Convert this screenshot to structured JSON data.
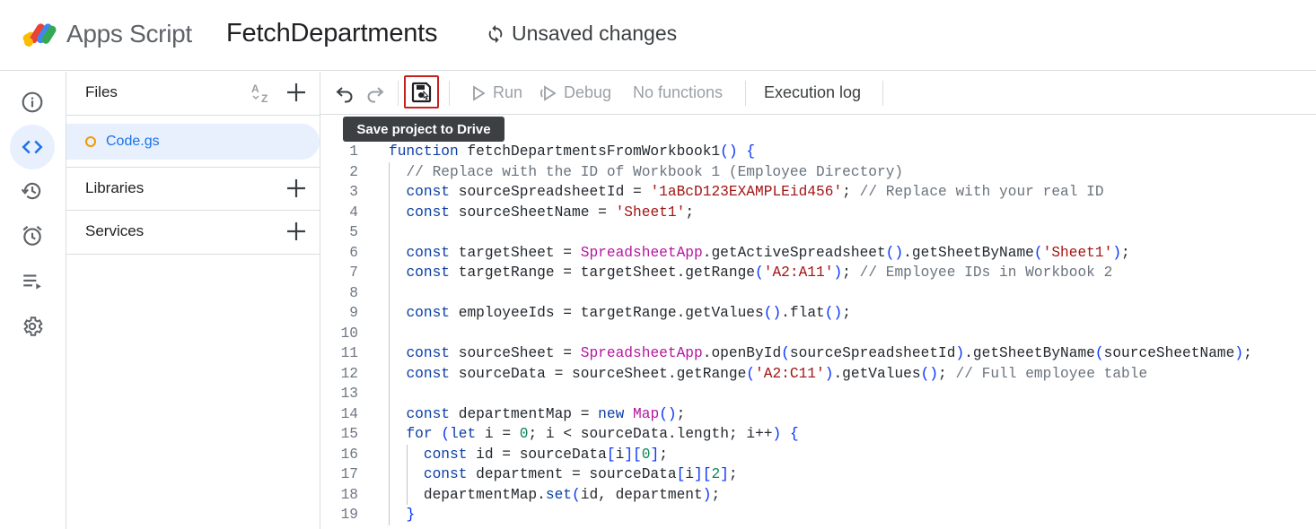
{
  "header": {
    "app_name": "Apps Script",
    "project_name": "FetchDepartments",
    "status": "Unsaved changes"
  },
  "rail": {
    "items": [
      {
        "name": "overview",
        "icon": "info-icon"
      },
      {
        "name": "editor",
        "icon": "code-icon",
        "active": true
      },
      {
        "name": "executions",
        "icon": "history-icon"
      },
      {
        "name": "triggers",
        "icon": "alarm-icon"
      },
      {
        "name": "execution-list",
        "icon": "playlist-icon"
      },
      {
        "name": "settings",
        "icon": "gear-icon"
      }
    ]
  },
  "files_panel": {
    "files_label": "Files",
    "sort_icon": "az-sort-icon",
    "files": [
      {
        "name": "Code.gs"
      }
    ],
    "libraries_label": "Libraries",
    "services_label": "Services"
  },
  "toolbar": {
    "run_label": "Run",
    "debug_label": "Debug",
    "function_select": "No functions",
    "execution_log_label": "Execution log",
    "save_tooltip": "Save project to Drive"
  },
  "colors": {
    "accent": "#1a73e8",
    "active_bg": "#e8f0fe",
    "save_highlight": "#c5221f",
    "unsaved_dot": "#f29900"
  },
  "code": {
    "language": "javascript",
    "lines": [
      {
        "n": "1",
        "text": "function fetchDepartmentsFromWorkbook1() {"
      },
      {
        "n": "2",
        "text": "  // Replace with the ID of Workbook 1 (Employee Directory)"
      },
      {
        "n": "3",
        "text": "  const sourceSpreadsheetId = '1aBcD123EXAMPLEid456'; // Replace with your real ID"
      },
      {
        "n": "4",
        "text": "  const sourceSheetName = 'Sheet1';"
      },
      {
        "n": "5",
        "text": ""
      },
      {
        "n": "6",
        "text": "  const targetSheet = SpreadsheetApp.getActiveSpreadsheet().getSheetByName('Sheet1');"
      },
      {
        "n": "7",
        "text": "  const targetRange = targetSheet.getRange('A2:A11'); // Employee IDs in Workbook 2"
      },
      {
        "n": "8",
        "text": ""
      },
      {
        "n": "9",
        "text": "  const employeeIds = targetRange.getValues().flat();"
      },
      {
        "n": "10",
        "text": ""
      },
      {
        "n": "11",
        "text": "  const sourceSheet = SpreadsheetApp.openById(sourceSpreadsheetId).getSheetByName(sourceSheetName);"
      },
      {
        "n": "12",
        "text": "  const sourceData = sourceSheet.getRange('A2:C11').getValues(); // Full employee table"
      },
      {
        "n": "13",
        "text": ""
      },
      {
        "n": "14",
        "text": "  const departmentMap = new Map();"
      },
      {
        "n": "15",
        "text": "  for (let i = 0; i < sourceData.length; i++) {"
      },
      {
        "n": "16",
        "text": "    const id = sourceData[i][0];"
      },
      {
        "n": "17",
        "text": "    const department = sourceData[i][2];"
      },
      {
        "n": "18",
        "text": "    departmentMap.set(id, department);"
      },
      {
        "n": "19",
        "text": "  }"
      }
    ]
  }
}
